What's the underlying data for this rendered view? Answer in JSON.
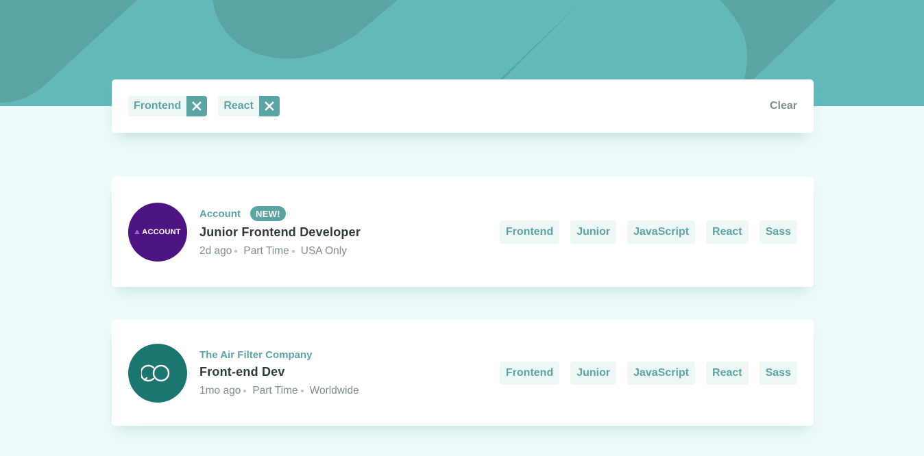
{
  "colors": {
    "primary": "#5ba4a4",
    "background": "#effafa",
    "header": "#5ba4a4",
    "tag_bg": "#eef6f6",
    "text_dark": "#2c3a3a",
    "text_muted": "#7b8e8e"
  },
  "filters": {
    "active": [
      {
        "label": "Frontend",
        "remove_icon": "close-icon"
      },
      {
        "label": "React",
        "remove_icon": "close-icon"
      }
    ],
    "clear_label": "Clear"
  },
  "jobs": [
    {
      "company": "Account",
      "logo_text": "ACCOUNT",
      "logo_color": "#4e1483",
      "badge": "NEW!",
      "position": "Junior Frontend Developer",
      "posted": "2d ago",
      "contract": "Part Time",
      "location": "USA Only",
      "tags": [
        "Frontend",
        "Junior",
        "JavaScript",
        "React",
        "Sass"
      ]
    },
    {
      "company": "The Air Filter Company",
      "logo_icon": "interlocking-rings-icon",
      "logo_color": "#1b7570",
      "position": "Front-end Dev",
      "posted": "1mo ago",
      "contract": "Part Time",
      "location": "Worldwide",
      "tags": [
        "Frontend",
        "Junior",
        "JavaScript",
        "React",
        "Sass"
      ]
    }
  ]
}
